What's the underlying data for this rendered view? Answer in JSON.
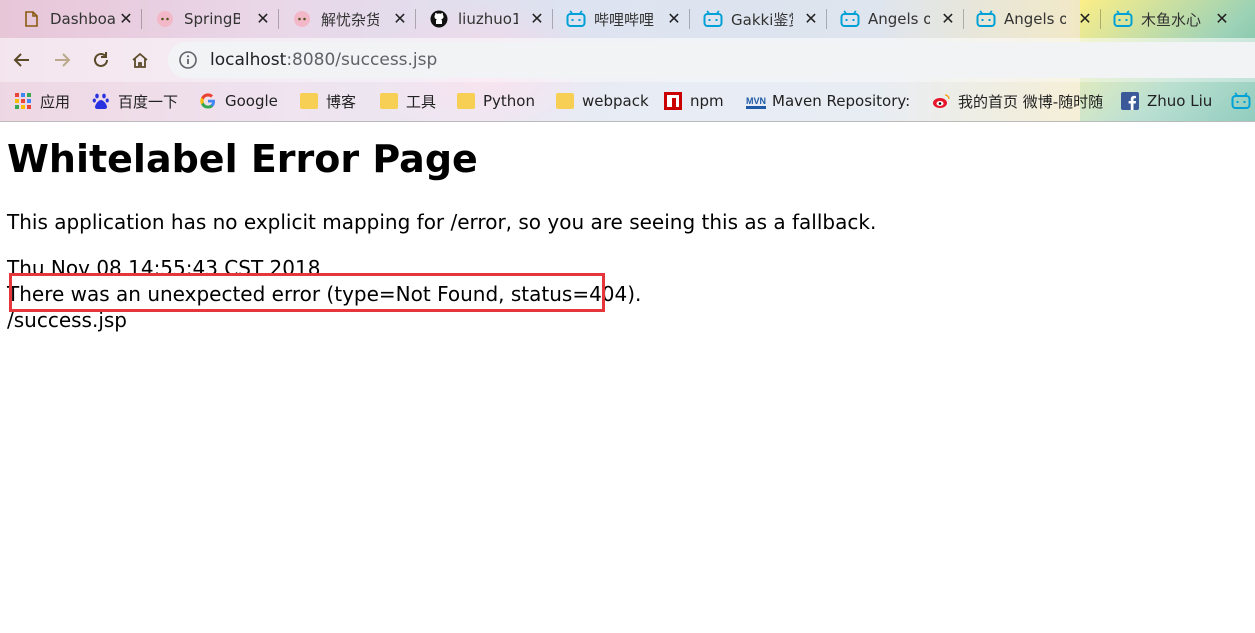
{
  "browser": {
    "tabs": [
      {
        "title": "Dashboa",
        "icon": "document-icon"
      },
      {
        "title": "SpringB",
        "icon": "anime-avatar-icon"
      },
      {
        "title": "解忧杂货",
        "icon": "anime-avatar-icon"
      },
      {
        "title": "liuzhuo1",
        "icon": "github-icon"
      },
      {
        "title": "哔哩哔哩",
        "icon": "bilibili-icon"
      },
      {
        "title": "Gakki鉴赏",
        "icon": "bilibili-icon"
      },
      {
        "title": "Angels o",
        "icon": "bilibili-icon"
      },
      {
        "title": "Angels o",
        "icon": "bilibili-icon"
      },
      {
        "title": "木鱼水心",
        "icon": "bilibili-icon"
      }
    ],
    "address": {
      "host": "localhost",
      "rest": ":8080/success.jsp"
    },
    "bookmarks": [
      {
        "label": "应用",
        "icon": "apps-grid-icon"
      },
      {
        "label": "百度一下",
        "icon": "baidu-icon"
      },
      {
        "label": "Google",
        "icon": "google-icon"
      },
      {
        "label": "博客",
        "icon": "folder-icon"
      },
      {
        "label": "工具",
        "icon": "folder-icon"
      },
      {
        "label": "Python",
        "icon": "folder-icon"
      },
      {
        "label": "webpack",
        "icon": "folder-icon"
      },
      {
        "label": "npm",
        "icon": "npm-icon"
      },
      {
        "label": "Maven Repository: ",
        "icon": "mvn-icon"
      },
      {
        "label": "我的首页 微博-随时随",
        "icon": "weibo-icon"
      },
      {
        "label": "Zhuo Liu",
        "icon": "facebook-icon"
      }
    ],
    "colors": {
      "bilibili": "#00a1d6",
      "highlight": "#e5363b"
    }
  },
  "page": {
    "heading": "Whitelabel Error Page",
    "message": "This application has no explicit mapping for /error, so you are seeing this as a fallback.",
    "timestamp": "Thu Nov 08 14:55:43 CST 2018",
    "error": "There was an unexpected error (type=Not Found, status=404).",
    "path": "/success.jsp"
  }
}
